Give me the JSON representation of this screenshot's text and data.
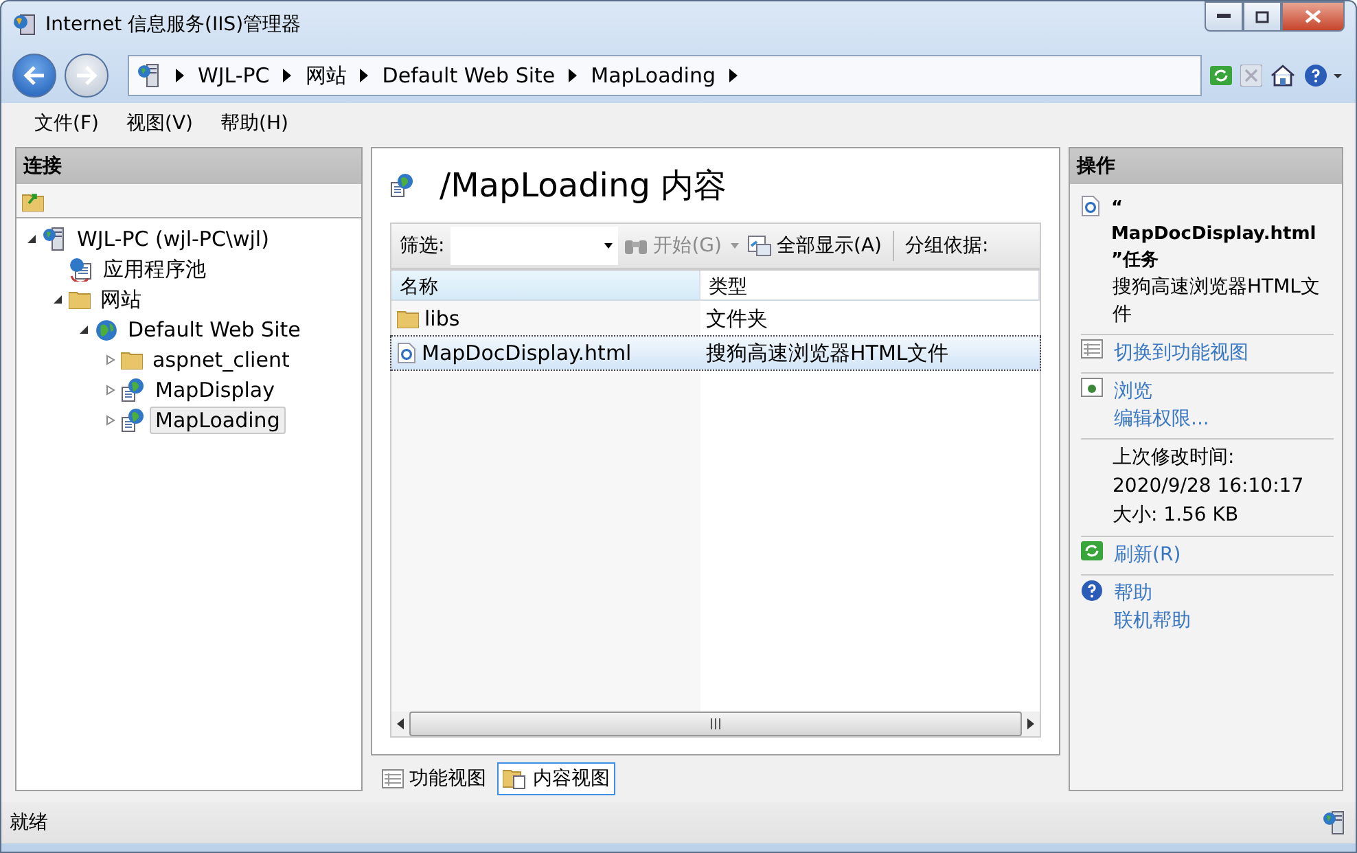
{
  "window": {
    "title": "Internet 信息服务(IIS)管理器"
  },
  "address": {
    "segments": [
      "WJL-PC",
      "网站",
      "Default Web Site",
      "MapLoading"
    ]
  },
  "menu": [
    "文件(F)",
    "视图(V)",
    "帮助(H)"
  ],
  "connections": {
    "title": "连接",
    "tree": [
      {
        "label": "WJL-PC (wjl-PC\\wjl)",
        "kind": "server",
        "expanded": true,
        "selected": false,
        "children": [
          {
            "label": "应用程序池",
            "kind": "pool",
            "selected": false
          },
          {
            "label": "网站",
            "kind": "sites",
            "expanded": true,
            "selected": false,
            "children": [
              {
                "label": "Default Web Site",
                "kind": "site",
                "expanded": true,
                "selected": false,
                "children": [
                  {
                    "label": "aspnet_client",
                    "kind": "folder",
                    "expanded": false,
                    "selected": false
                  },
                  {
                    "label": "MapDisplay",
                    "kind": "app",
                    "expanded": false,
                    "selected": false
                  },
                  {
                    "label": "MapLoading",
                    "kind": "app",
                    "expanded": false,
                    "selected": true
                  }
                ]
              }
            ]
          }
        ]
      }
    ]
  },
  "content": {
    "title": "/MapLoading 内容",
    "filter": {
      "label": "筛选:",
      "start": "开始(G)",
      "show_all": "全部显示(A)",
      "group_by": "分组依据:"
    },
    "columns": [
      "名称",
      "类型"
    ],
    "rows": [
      {
        "name": "libs",
        "type": "文件夹",
        "kind": "folder",
        "selected": false
      },
      {
        "name": "MapDocDisplay.html",
        "type": "搜狗高速浏览器HTML文件",
        "kind": "file",
        "selected": true
      }
    ],
    "view_tabs": [
      {
        "label": "功能视图",
        "kind": "features",
        "selected": false
      },
      {
        "label": "内容视图",
        "kind": "content",
        "selected": true
      }
    ]
  },
  "actions": {
    "title": "操作",
    "heading": "“ MapDocDisplay.html ”任务",
    "subtitle": "搜狗高速浏览器HTML文件",
    "sections": [
      {
        "kind": "features",
        "items": [
          "切换到功能视图"
        ]
      },
      {
        "kind": "browse",
        "items": [
          "浏览",
          "编辑权限..."
        ]
      },
      {
        "kind": "info",
        "items": [
          "上次修改时间:",
          "2020/9/28 16:10:17",
          "大小: 1.56 KB"
        ]
      },
      {
        "kind": "refresh",
        "items": [
          "刷新(R)"
        ]
      },
      {
        "kind": "help",
        "items": [
          "帮助",
          "联机帮助"
        ]
      }
    ]
  },
  "status_bar": {
    "text": "就绪"
  }
}
